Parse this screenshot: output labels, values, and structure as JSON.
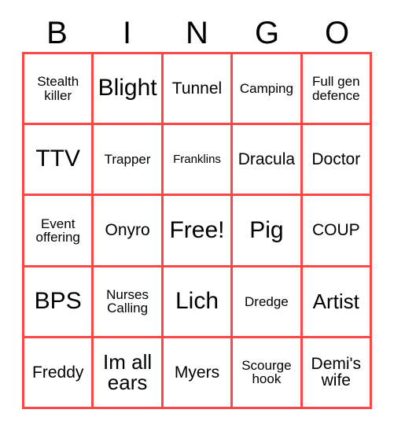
{
  "card": {
    "title": "BINGO",
    "header_letters": [
      "B",
      "I",
      "N",
      "G",
      "O"
    ],
    "border_color": "#fc4747",
    "text_color": "#000000",
    "background_color": "#ffffff",
    "columns": 5,
    "rows": 5,
    "free_space": "Free!",
    "cells": [
      {
        "text": "Stealth killer",
        "size": "sm"
      },
      {
        "text": "Blight",
        "size": "xl"
      },
      {
        "text": "Tunnel",
        "size": "md"
      },
      {
        "text": "Camping",
        "size": "sm"
      },
      {
        "text": "Full gen defence",
        "size": "sm"
      },
      {
        "text": "TTV",
        "size": "xl"
      },
      {
        "text": "Trapper",
        "size": "sm"
      },
      {
        "text": "Franklins",
        "size": "xs"
      },
      {
        "text": "Dracula",
        "size": "md"
      },
      {
        "text": "Doctor",
        "size": "md"
      },
      {
        "text": "Event offering",
        "size": "sm"
      },
      {
        "text": "Onyro",
        "size": "md"
      },
      {
        "text": "Free!",
        "size": "xl"
      },
      {
        "text": "Pig",
        "size": "xl"
      },
      {
        "text": "COUP",
        "size": "md"
      },
      {
        "text": "BPS",
        "size": "xl"
      },
      {
        "text": "Nurses Calling",
        "size": "sm"
      },
      {
        "text": "Lich",
        "size": "xl"
      },
      {
        "text": "Dredge",
        "size": "sm"
      },
      {
        "text": "Artist",
        "size": "lg"
      },
      {
        "text": "Freddy",
        "size": "md"
      },
      {
        "text": "Im all ears",
        "size": "lg"
      },
      {
        "text": "Myers",
        "size": "md"
      },
      {
        "text": "Scourge hook",
        "size": "sm"
      },
      {
        "text": "Demi's wife",
        "size": "md"
      }
    ]
  }
}
